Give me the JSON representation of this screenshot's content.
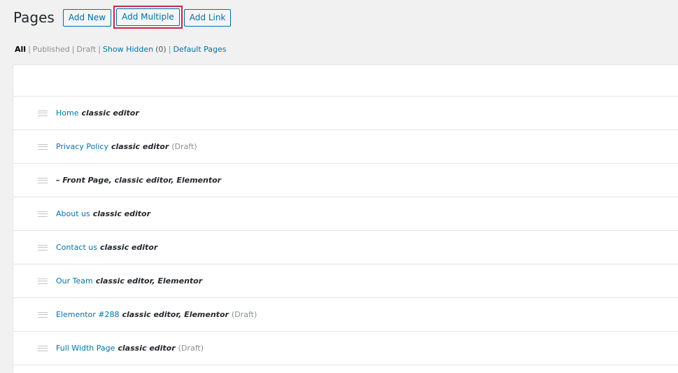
{
  "header": {
    "title": "Pages",
    "buttons": {
      "add_new": "Add New",
      "add_multiple": "Add Multiple",
      "add_link": "Add Link"
    },
    "highlight_color": "#c9264d"
  },
  "filters": {
    "all": "All",
    "published": "Published",
    "draft": "Draft",
    "show_hidden": "Show Hidden",
    "show_hidden_count": "(0)",
    "default_pages": "Default Pages",
    "separator": "|"
  },
  "pages": [
    {
      "title": "Home",
      "states": "classic editor",
      "status": ""
    },
    {
      "title": "Privacy Policy",
      "states": "classic editor",
      "status": "(Draft)"
    },
    {
      "title": "",
      "states": "– Front Page, classic editor, Elementor",
      "status": ""
    },
    {
      "title": "About us",
      "states": "classic editor",
      "status": ""
    },
    {
      "title": "Contact us",
      "states": "classic editor",
      "status": ""
    },
    {
      "title": "Our Team",
      "states": "classic editor, Elementor",
      "status": ""
    },
    {
      "title": "Elementor #288",
      "states": "classic editor, Elementor",
      "status": "(Draft)"
    },
    {
      "title": "Full Width Page",
      "states": "classic editor",
      "status": "(Draft)"
    }
  ],
  "colors": {
    "link": "#0073aa",
    "button_border": "#0071a1",
    "background": "#f1f1f1"
  }
}
